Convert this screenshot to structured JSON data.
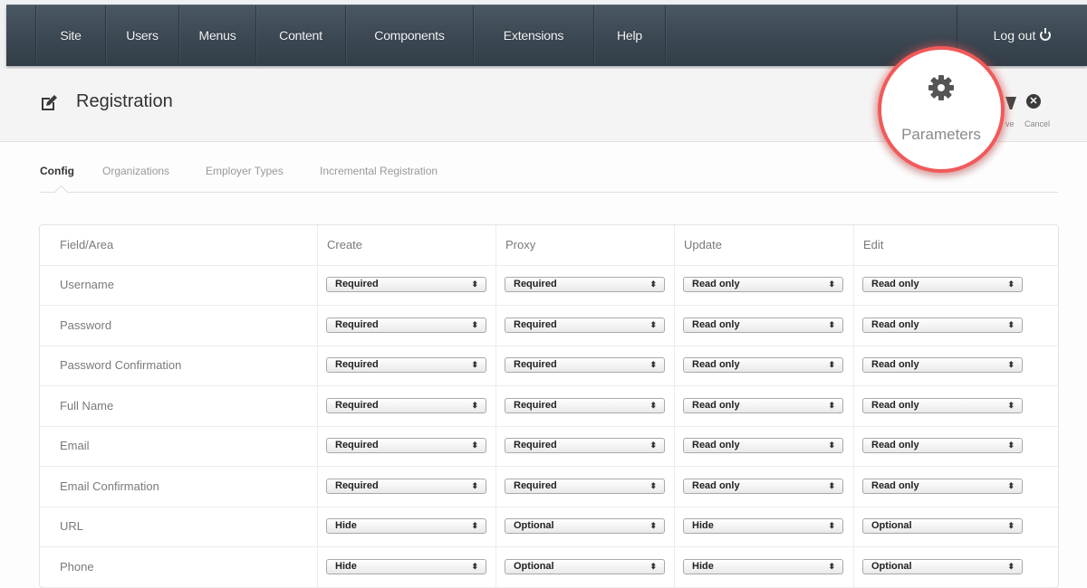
{
  "nav": {
    "items": [
      "Site",
      "Users",
      "Menus",
      "Content",
      "Components",
      "Extensions",
      "Help"
    ],
    "logout": "Log out"
  },
  "header": {
    "title": "Registration",
    "parameters_label": "Parameters",
    "save_label": "ve",
    "cancel_label": "Cancel"
  },
  "tabs": [
    "Config",
    "Organizations",
    "Employer Types",
    "Incremental Registration"
  ],
  "table": {
    "columns": [
      "Field/Area",
      "Create",
      "Proxy",
      "Update",
      "Edit"
    ],
    "rows": [
      {
        "field": "Username",
        "values": [
          "Required",
          "Required",
          "Read only",
          "Read only"
        ]
      },
      {
        "field": "Password",
        "values": [
          "Required",
          "Required",
          "Read only",
          "Read only"
        ]
      },
      {
        "field": "Password Confirmation",
        "values": [
          "Required",
          "Required",
          "Read only",
          "Read only"
        ]
      },
      {
        "field": "Full Name",
        "values": [
          "Required",
          "Required",
          "Read only",
          "Read only"
        ]
      },
      {
        "field": "Email",
        "values": [
          "Required",
          "Required",
          "Read only",
          "Read only"
        ]
      },
      {
        "field": "Email Confirmation",
        "values": [
          "Required",
          "Required",
          "Read only",
          "Read only"
        ]
      },
      {
        "field": "URL",
        "values": [
          "Hide",
          "Optional",
          "Hide",
          "Optional"
        ]
      },
      {
        "field": "Phone",
        "values": [
          "Hide",
          "Optional",
          "Hide",
          "Optional"
        ]
      }
    ]
  },
  "colors": {
    "nav_bg": "#3b4752",
    "callout_ring": "#f15a5a"
  }
}
